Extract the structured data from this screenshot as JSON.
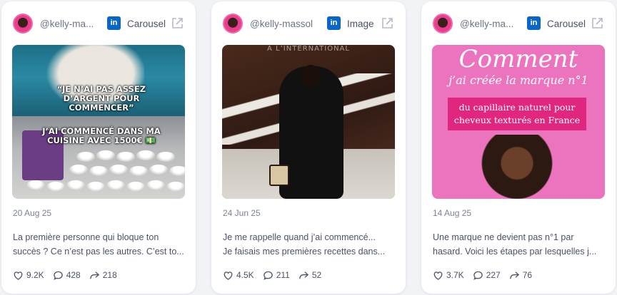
{
  "cards": [
    {
      "handle": "@kelly-ma...",
      "network_icon": "linkedin-icon",
      "network_badge": "in",
      "type": "Carousel",
      "image_captions": [
        "“JE N’AI PAS ASSEZ D’ARGENT POUR COMMENCER”",
        "J’AI COMMENCÉ DANS MA CUISINE AVEC 1500€ 💵"
      ],
      "date": "20 Aug 25",
      "description_lines": [
        "La première personne qui bloque ton",
        "succès ? Ce n’est pas les autres. C’est to..."
      ],
      "likes": "9.2K",
      "comments": "428",
      "shares": "218"
    },
    {
      "handle": "@kelly-massol",
      "network_icon": "linkedin-icon",
      "network_badge": "in",
      "type": "Image",
      "image_watermark": "À L’INTERNATIONAL",
      "date": "24 Jun 25",
      "description_lines": [
        "Je me rappelle quand j’ai commencé...",
        "Je faisais mes premières recettes dans..."
      ],
      "likes": "4.5K",
      "comments": "211",
      "shares": "52"
    },
    {
      "handle": "@kelly-ma...",
      "network_icon": "linkedin-icon",
      "network_badge": "in",
      "type": "Carousel",
      "image_title": "Comment",
      "image_subtitle": "j’ai créée la marque n°1",
      "image_band": "du capillaire naturel pour cheveux texturés en France",
      "date": "14 Aug 25",
      "description_lines": [
        "Une marque ne devient pas n°1 par",
        "hasard. Voici les étapes par lesquelles j..."
      ],
      "likes": "3.7K",
      "comments": "227",
      "shares": "76"
    }
  ],
  "colors": {
    "linkedin_blue": "#0a66c2",
    "accent_pink": "#e0267e",
    "text_muted": "#7b8294"
  }
}
